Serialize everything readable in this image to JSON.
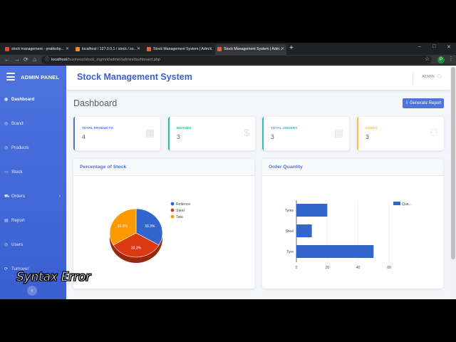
{
  "browser": {
    "tabs": [
      {
        "title": "stock management - pratikshp...",
        "fav_color": "#ea4335",
        "active": false
      },
      {
        "title": "localhost / 127.0.0.1 / stock / so...",
        "fav_color": "#f28b24",
        "active": false
      },
      {
        "title": "Stock Management System | Adm...",
        "fav_color": "#e8603c",
        "active": false
      },
      {
        "title": "Stock Management System | Adm...",
        "fav_color": "#e8603c",
        "active": true
      }
    ],
    "new_tab": "+",
    "window_controls": [
      "–",
      "□",
      "✕"
    ],
    "url_host": "localhost",
    "url_path": "/business/stock_mgmnt/admin/admin/dashboard.php",
    "profile_initial": "P"
  },
  "sidebar": {
    "title": "ADMIN PANEL",
    "items": [
      {
        "label": "Dashboard",
        "icon": "◉",
        "active": true,
        "has_arrow": false
      },
      {
        "label": "Brand",
        "icon": "◎",
        "active": false,
        "has_arrow": false
      },
      {
        "label": "Products",
        "icon": "◎",
        "active": false,
        "has_arrow": false
      },
      {
        "label": "Stock",
        "icon": "▭",
        "active": false,
        "has_arrow": false
      },
      {
        "label": "Orders",
        "icon": "⛟",
        "active": false,
        "has_arrow": true
      },
      {
        "label": "Report",
        "icon": "▤",
        "active": false,
        "has_arrow": false
      },
      {
        "label": "Users",
        "icon": "◎",
        "active": false,
        "has_arrow": false
      },
      {
        "label": "Turnover",
        "icon": "⟳",
        "active": false,
        "has_arrow": false
      }
    ],
    "toggle": "‹"
  },
  "topbar": {
    "app_title": "Stock Management System",
    "user": "ADMIN"
  },
  "page": {
    "title": "Dashboard",
    "generate_button": "⇩ Generate Report"
  },
  "cards": [
    {
      "label": "TOTAL PRODUCTS",
      "value": "4",
      "color": "#4e73df",
      "icon": "▦"
    },
    {
      "label": "BRANDS",
      "value": "3",
      "color": "#1cc88a",
      "icon": "$"
    },
    {
      "label": "TOTAL ORDERS",
      "value": "3",
      "color": "#36b9cc",
      "icon": "▤"
    },
    {
      "label": "USERS",
      "value": "3",
      "color": "#f6c23e",
      "icon": "⚇"
    }
  ],
  "panels": {
    "stock_title": "Percentage of Stock",
    "orders_title": "Order Quantity"
  },
  "chart_data": [
    {
      "type": "pie",
      "title": "Percentage of Stock",
      "categories": [
        "Relience",
        "Steel",
        "Tata"
      ],
      "values": [
        33.3,
        33.3,
        33.3
      ],
      "labels": [
        "33.3%",
        "33.3%",
        "33.3%"
      ],
      "colors": [
        "#3366cc",
        "#dc3912",
        "#ff9900"
      ],
      "legend": "right"
    },
    {
      "type": "bar",
      "orientation": "horizontal",
      "title": "Order Quantity",
      "categories": [
        "Tyres",
        "Steel",
        "Tyre"
      ],
      "series": [
        {
          "name": "Qua...",
          "values": [
            20,
            10,
            50
          ],
          "color": "#3366cc"
        }
      ],
      "xlim": [
        0,
        60
      ],
      "xticks": [
        "0",
        "20",
        "40",
        "60"
      ],
      "grid": true,
      "legend": "top-right"
    }
  ],
  "watermark": "Syntax Error"
}
